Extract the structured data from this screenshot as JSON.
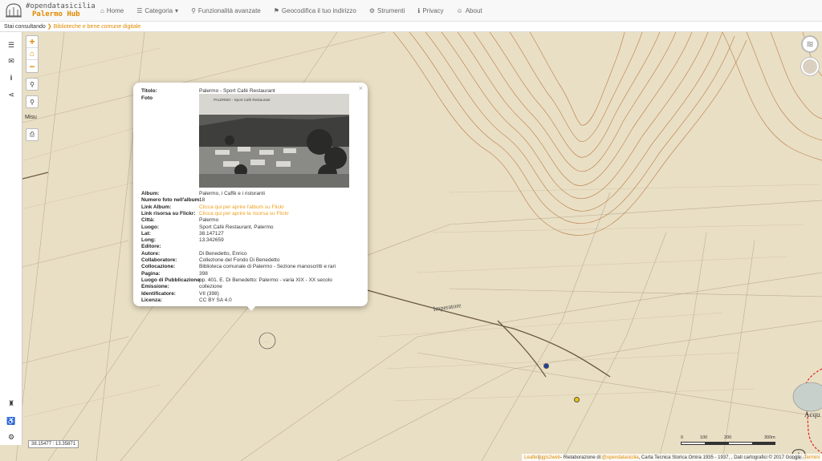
{
  "nav": {
    "brand_top": "#opendatasicilia",
    "brand_sub": "Palermo Hub",
    "items": [
      {
        "icon": "home-icon",
        "glyph": "⌂",
        "label": "Home"
      },
      {
        "icon": "list-icon",
        "glyph": "☰",
        "label": "Categoria",
        "dropdown": "▾"
      },
      {
        "icon": "search-icon",
        "glyph": "⚲",
        "label": "Funzionalità avanzate"
      },
      {
        "icon": "map-marker-icon",
        "glyph": "⚑",
        "label": "Geocodifica il tuo indirizzo"
      },
      {
        "icon": "cog-icon",
        "glyph": "⚙",
        "label": "Strumenti"
      },
      {
        "icon": "info-icon",
        "glyph": "ℹ",
        "label": "Privacy"
      },
      {
        "icon": "user-icon",
        "glyph": "☺",
        "label": "About"
      }
    ]
  },
  "breadcrumb": {
    "label": "Stai consultando",
    "arrow": "❯",
    "current": "Biblioteche e bene comune digitale"
  },
  "map_tools": {
    "zoom_in": "+",
    "home": "⌂",
    "zoom_out": "−",
    "measure_label": "Misu"
  },
  "popup": {
    "close": "×",
    "rows_top": [
      {
        "key": "Titolo:",
        "value": "Palermo - Sport Café Restaurant"
      },
      {
        "key": "Foto",
        "value": ""
      }
    ],
    "photo_caption": "PALERMO - Sport Café Restaurant",
    "rows": [
      {
        "key": "Album:",
        "value": "Palermo, i Caffè e i ristoranti",
        "link": false
      },
      {
        "key": "Numero foto nell'album:",
        "value": "18",
        "link": false
      },
      {
        "key": "Link Album:",
        "value": "Clicca qui per aprire l'album su Flickr",
        "link": true
      },
      {
        "key": "Link risorsa su Flickr:",
        "value": "Clicca qui per aprire la risorsa su Flickr",
        "link": true
      },
      {
        "key": "Città:",
        "value": "Palermo",
        "link": false
      },
      {
        "key": "Luogo:",
        "value": "Sport Café Restaurant, Palermo",
        "link": false
      },
      {
        "key": "Lat:",
        "value": "38.147127",
        "link": false
      },
      {
        "key": "Long:",
        "value": "13.342659",
        "link": false
      },
      {
        "key": "Editore:",
        "value": "",
        "link": false
      },
      {
        "key": "Autore:",
        "value": "Di Benedetto, Enrico",
        "link": false
      },
      {
        "key": "Collaboratore:",
        "value": "Collezione del Fondo Di Benedetto",
        "link": false
      },
      {
        "key": "Collocazione:",
        "value": "Biblioteca comunale di Palermo - Sezione manoscritti e rari",
        "link": false
      },
      {
        "key": "Pagina:",
        "value": "398",
        "link": false
      },
      {
        "key": "Luogo di Pubblicazione:",
        "value": "pp. 401. E. Di Benedetto: Palermo - varia XIX - XX secolo",
        "link": false
      },
      {
        "key": "Emissione:",
        "value": "collezione",
        "link": false
      },
      {
        "key": "Identificatore:",
        "value": "VII (398)",
        "link": false
      },
      {
        "key": "Licenza:",
        "value": "CC BY SA 4.0",
        "link": false
      }
    ]
  },
  "coords": "38.15477 : 13.35871",
  "scale": {
    "labels": [
      "0",
      "100",
      "200",
      "300m"
    ]
  },
  "attribution": {
    "leaflet": "Leaflet",
    "sep1": " | ",
    "qgis": "qgis2web",
    "text1": " - Rielaborazione di: ",
    "ods": "@opendatasicilia",
    "text2": ", Carta Tecnica Storica Omira 1935 - 1937, , Dati cartografici © 2017 Google - ",
    "terms": "Termini"
  },
  "map_labels": {
    "street1": "Imperatore",
    "street2": "Acqu"
  },
  "colors": {
    "accent": "#e08a00",
    "link": "#f0a020",
    "marker_blue": "#1f3fa0",
    "marker_yellow": "#f2c200",
    "map_base": "#e9dfc4",
    "contour": "#b5733f"
  }
}
